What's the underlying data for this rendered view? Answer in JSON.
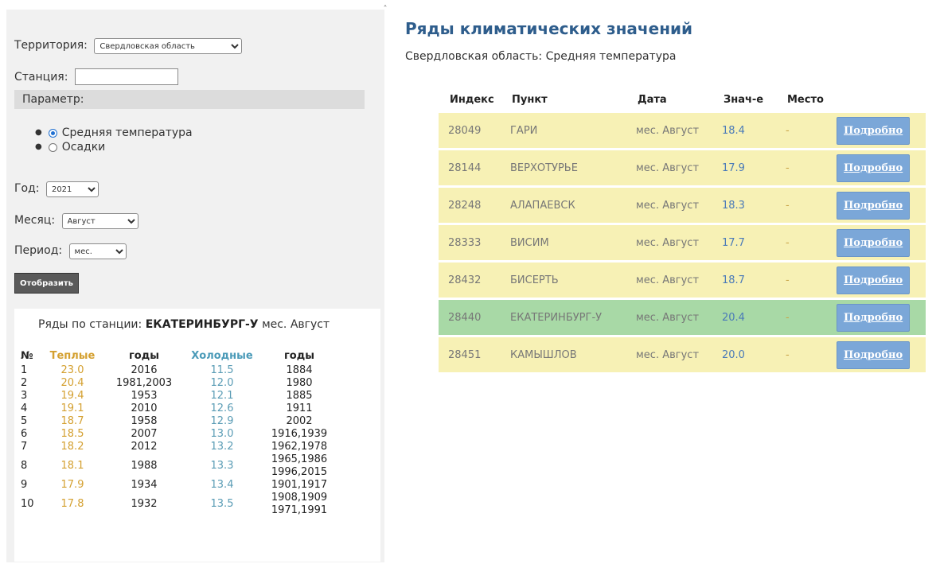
{
  "form": {
    "territory_label": "Территория:",
    "territory_value": "Свердловская область",
    "station_label": "Станция:",
    "station_value": "",
    "parameter_label": "Параметр:",
    "radio_options": [
      {
        "label": "Средняя температура",
        "selected": true
      },
      {
        "label": "Осадки",
        "selected": false
      }
    ],
    "year_label": "Год:",
    "year_value": "2021",
    "month_label": "Месяц:",
    "month_value": "Август",
    "period_label": "Период:",
    "period_value": "мес.",
    "show_button": "Отобразить"
  },
  "records": {
    "caption_prefix": "Ряды по станции:",
    "station": "ЕКАТЕРИНБУРГ-У",
    "caption_suffix": "мес. Август",
    "headers": {
      "no": "№",
      "warm": "Теплые",
      "warm_years": "годы",
      "cold": "Холодные",
      "cold_years": "годы"
    },
    "rows": [
      {
        "no": "1",
        "warm": "23.0",
        "warm_years": "2016",
        "cold": "11.5",
        "cold_years": "1884"
      },
      {
        "no": "2",
        "warm": "20.4",
        "warm_years": "1981,2003",
        "cold": "12.0",
        "cold_years": "1980"
      },
      {
        "no": "3",
        "warm": "19.4",
        "warm_years": "1953",
        "cold": "12.1",
        "cold_years": "1885"
      },
      {
        "no": "4",
        "warm": "19.1",
        "warm_years": "2010",
        "cold": "12.6",
        "cold_years": "1911"
      },
      {
        "no": "5",
        "warm": "18.7",
        "warm_years": "1958",
        "cold": "12.9",
        "cold_years": "2002"
      },
      {
        "no": "6",
        "warm": "18.5",
        "warm_years": "2007",
        "cold": "13.0",
        "cold_years": "1916,1939"
      },
      {
        "no": "7",
        "warm": "18.2",
        "warm_years": "2012",
        "cold": "13.2",
        "cold_years": "1962,1978"
      },
      {
        "no": "8",
        "warm": "18.1",
        "warm_years": "1988",
        "cold": "13.3",
        "cold_years": "1965,1986\n1996,2015"
      },
      {
        "no": "9",
        "warm": "17.9",
        "warm_years": "1934",
        "cold": "13.4",
        "cold_years": "1901,1917"
      },
      {
        "no": "10",
        "warm": "17.8",
        "warm_years": "1932",
        "cold": "13.5",
        "cold_years": "1908,1909\n1971,1991"
      }
    ]
  },
  "main": {
    "title": "Ряды климатических значений",
    "subtitle": "Свердловская область: Средняя температура",
    "headers": {
      "index": "Индекс",
      "point": "Пункт",
      "date": "Дата",
      "value": "Знач-е",
      "place": "Место"
    },
    "button_label": "Подробно",
    "rows": [
      {
        "index": "28049",
        "point": "ГАРИ",
        "date": "мес. Август",
        "value": "18.4",
        "place": "-",
        "highlight": false
      },
      {
        "index": "28144",
        "point": "ВЕРХОТУРЬЕ",
        "date": "мес. Август",
        "value": "17.9",
        "place": "-",
        "highlight": false
      },
      {
        "index": "28248",
        "point": "АЛАПАЕВСК",
        "date": "мес. Август",
        "value": "18.3",
        "place": "-",
        "highlight": false
      },
      {
        "index": "28333",
        "point": "ВИСИМ",
        "date": "мес. Август",
        "value": "17.7",
        "place": "-",
        "highlight": false
      },
      {
        "index": "28432",
        "point": "БИСЕРТЬ",
        "date": "мес. Август",
        "value": "18.7",
        "place": "-",
        "highlight": false
      },
      {
        "index": "28440",
        "point": "ЕКАТЕРИНБУРГ-У",
        "date": "мес. Август",
        "value": "20.4",
        "place": "-",
        "highlight": true
      },
      {
        "index": "28451",
        "point": "КАМЫШЛОВ",
        "date": "мес. Август",
        "value": "20.0",
        "place": "-",
        "highlight": false
      }
    ]
  },
  "colors": {
    "heading": "#2e5d8c",
    "row_bg": "#f7f1b5",
    "row_highlight_bg": "#a8d9a6",
    "warm": "#d4a030",
    "cold": "#4a9ab8",
    "button_bg": "#7ba7d8"
  },
  "icons": {
    "scroll_up": "chevron-up-icon",
    "select_arrow": "chevron-down-icon"
  }
}
